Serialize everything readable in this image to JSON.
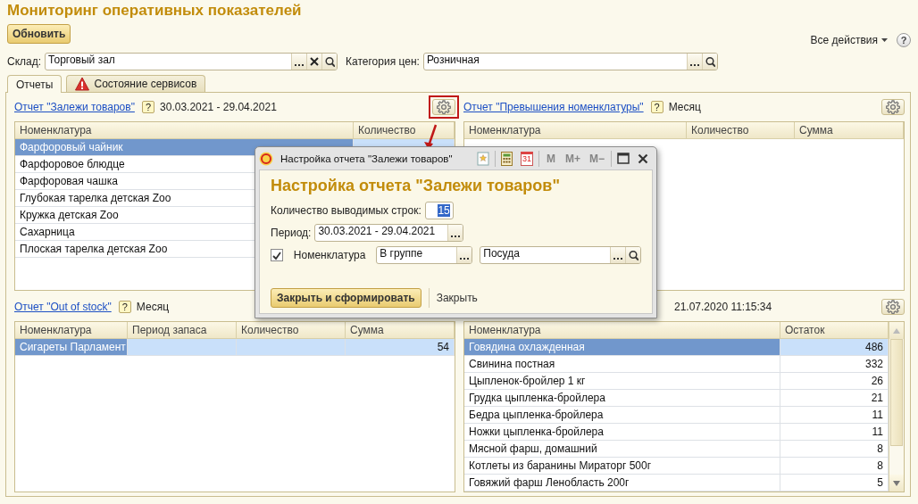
{
  "title": "Мониторинг оперативных показателей",
  "toolbar": {
    "refresh_button": "Обновить",
    "all_actions": "Все действия",
    "help_button": "?"
  },
  "filters": [
    {
      "label": "Склад:",
      "value": "Торговый зал",
      "clearable": true
    },
    {
      "label": "Категория цен:",
      "value": "Розничная",
      "clearable": false
    }
  ],
  "tabs": [
    {
      "label": "Отчеты",
      "selected": true,
      "warning": false
    },
    {
      "label": "Состояние сервисов",
      "selected": false,
      "warning": true
    }
  ],
  "reports": [
    {
      "link": "Отчет \"Залежи товаров\"",
      "help": "?",
      "period": "30.03.2021 - 29.04.2021",
      "settings_highlighted": true,
      "table": {
        "columns": [
          "Номенклатура",
          "Количество"
        ],
        "rows": [
          {
            "cells": [
              "Фарфоровый чайник"
            ],
            "selected": true
          },
          {
            "cells": [
              "Фарфоровое блюдце"
            ],
            "selected": false
          },
          {
            "cells": [
              "Фарфоровая чашка"
            ],
            "selected": false
          },
          {
            "cells": [
              "Глубокая тарелка детская Zoo"
            ],
            "selected": false
          },
          {
            "cells": [
              "Кружка детская Zoo"
            ],
            "selected": false
          },
          {
            "cells": [
              "Сахарница"
            ],
            "selected": false
          },
          {
            "cells": [
              "Плоская тарелка детская Zoo"
            ],
            "selected": false
          }
        ]
      }
    },
    {
      "link": "Отчет \"Превышения номенклатуры\"",
      "help": "?",
      "period": "Месяц",
      "settings_highlighted": false,
      "table": {
        "columns": [
          "Номенклатура",
          "Количество",
          "Сумма"
        ]
      }
    },
    {
      "link": "Отчет \"Out of stock\"",
      "help": "?",
      "period": "Месяц",
      "table": {
        "columns": [
          "Номенклатура",
          "Период запаса",
          "Количество",
          "Сумма"
        ],
        "rows": [
          {
            "cells": [
              "Сигареты Парламент",
              null,
              null,
              "54"
            ],
            "selected": true
          }
        ]
      }
    },
    {
      "period": "21.07.2020 11:15:34",
      "settings_highlighted": false,
      "table": {
        "columns": [
          "Номенклатура",
          "Остаток"
        ],
        "rows": [
          {
            "cells": [
              "Говядина охлажденная",
              "486"
            ],
            "selected": true
          },
          {
            "cells": [
              "Свинина постная",
              "332"
            ],
            "selected": false
          },
          {
            "cells": [
              "Цыпленок-бройлер 1 кг",
              "26"
            ],
            "selected": false
          },
          {
            "cells": [
              "Грудка цыпленка-бройлера",
              "21"
            ],
            "selected": false
          },
          {
            "cells": [
              "Бедра цыпленка-бройлера",
              "11"
            ],
            "selected": false
          },
          {
            "cells": [
              "Ножки цыпленка-бройлера",
              "11"
            ],
            "selected": false
          },
          {
            "cells": [
              "Мясной фарш, домашний",
              "8"
            ],
            "selected": false
          },
          {
            "cells": [
              "Котлеты из баранины Мираторг 500г",
              "8"
            ],
            "selected": false
          },
          {
            "cells": [
              "Говяжий фарш Ленобласть 200г",
              "5"
            ],
            "selected": false
          }
        ]
      }
    }
  ],
  "dialog": {
    "title": "Настройка отчета \"Залежи товаров\"",
    "calendar_day": "31",
    "memory_buttons": [
      {
        "label": "M",
        "disabled": true
      },
      {
        "label": "M+",
        "disabled": true
      },
      {
        "label": "M−",
        "disabled": true
      }
    ],
    "heading": "Настройка отчета \"Залежи товаров\"",
    "rows_label": "Количество выводимых строк:",
    "rows_value": "15",
    "period_label": "Период:",
    "period_value": "30.03.2021 - 29.04.2021",
    "filter": {
      "checked": true,
      "label": "Номенклатура",
      "condition": "В группе",
      "value": "Посуда"
    },
    "buttons": [
      {
        "label": "Закрыть и сформировать",
        "kind": "default"
      },
      {
        "label": "Закрыть",
        "kind": "flat"
      }
    ]
  }
}
